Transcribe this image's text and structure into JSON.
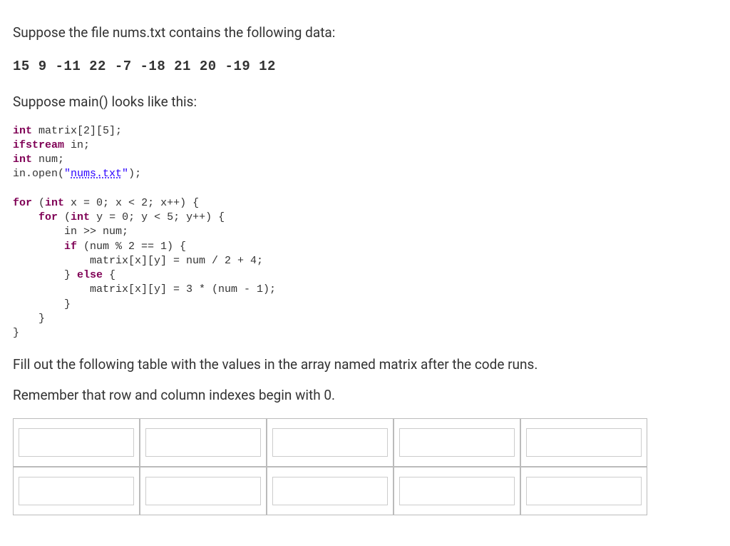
{
  "intro": "Suppose the file nums.txt contains the following data:",
  "file_contents": "15 9 -11 22 -7 -18 21 20 -19 12",
  "main_intro": "Suppose main() looks like this:",
  "code": {
    "decl1_kw": "int",
    "decl1_rest": " matrix[2][5];",
    "decl2_kw": "ifstream",
    "decl2_rest": " in;",
    "decl3_kw": "int",
    "decl3_rest": " num;",
    "open_pre": "in.open(",
    "open_q1": "\"",
    "open_str": "nums.txt",
    "open_q2": "\"",
    "open_post": ");",
    "for1_kw": "for",
    "for1_rest": " (",
    "for1_int": "int",
    "for1_body": " x = 0; x < 2; x++) {",
    "for2_indent": "    ",
    "for2_kw": "for",
    "for2_rest": " (",
    "for2_int": "int",
    "for2_body": " y = 0; y < 5; y++) {",
    "read_line": "        in >> num;",
    "if_indent": "        ",
    "if_kw": "if",
    "if_rest": " (num % 2 == 1) {",
    "if_body": "            matrix[x][y] = num / 2 + 4;",
    "else_indent": "        } ",
    "else_kw": "else",
    "else_rest": " {",
    "else_body": "            matrix[x][y] = 3 * (num - 1);",
    "close1": "        }",
    "close2": "    }",
    "close3": "}"
  },
  "question": "Fill out the following table with the values in the array named matrix after the code runs.",
  "remember": "Remember that row and column indexes begin with 0.",
  "answers": {
    "r0": [
      "",
      "",
      "",
      "",
      ""
    ],
    "r1": [
      "",
      "",
      "",
      "",
      ""
    ]
  }
}
